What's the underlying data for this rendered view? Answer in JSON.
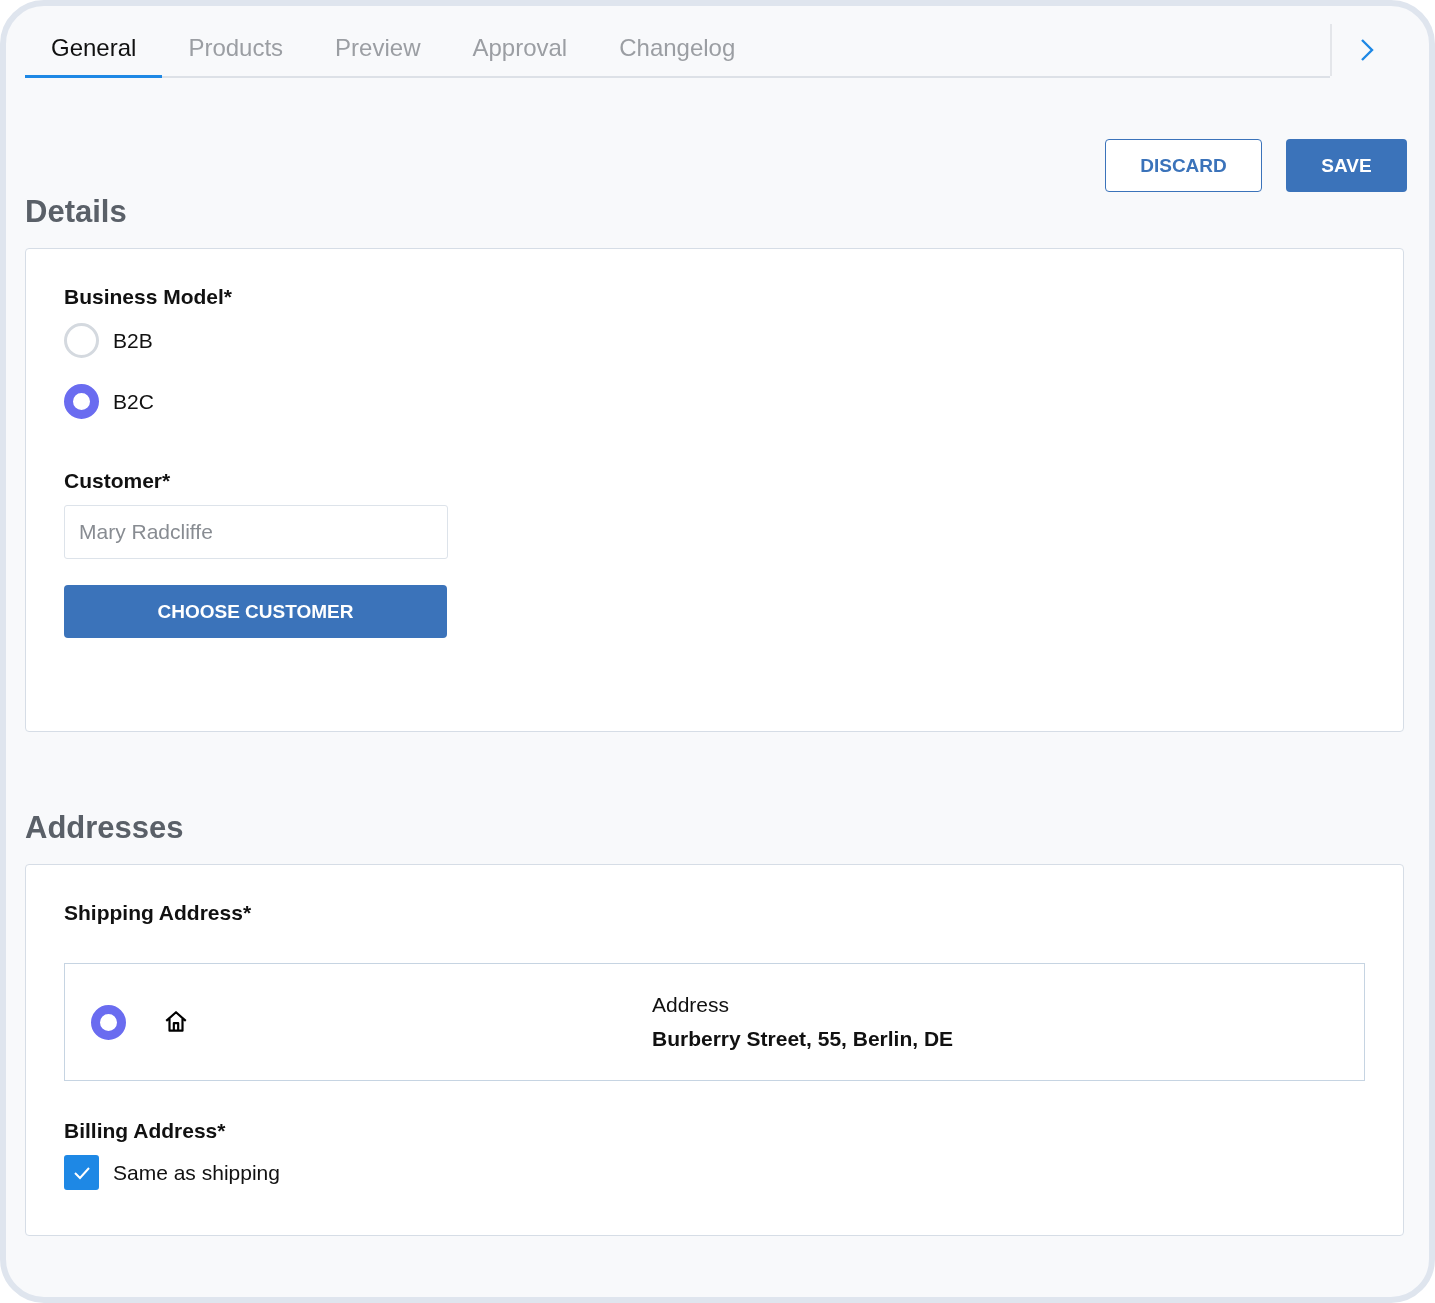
{
  "tabs": [
    {
      "label": "General",
      "selected": true
    },
    {
      "label": "Products",
      "selected": false
    },
    {
      "label": "Preview",
      "selected": false
    },
    {
      "label": "Approval",
      "selected": false
    },
    {
      "label": "Changelog",
      "selected": false
    }
  ],
  "actions": {
    "discard": "DISCARD",
    "save": "SAVE"
  },
  "details": {
    "title": "Details",
    "business_model": {
      "label": "Business Model*",
      "options": [
        {
          "label": "B2B",
          "selected": false
        },
        {
          "label": "B2C",
          "selected": true
        }
      ]
    },
    "customer": {
      "label": "Customer*",
      "value": "Mary Radcliffe",
      "button": "CHOOSE CUSTOMER"
    }
  },
  "addresses": {
    "title": "Addresses",
    "shipping": {
      "label": "Shipping Address*",
      "options": [
        {
          "selected": true,
          "heading": "Address",
          "address": "Burberry Street, 55, Berlin, DE"
        }
      ]
    },
    "billing": {
      "label": "Billing Address*",
      "same_as_shipping": {
        "label": "Same as shipping",
        "checked": true
      }
    }
  }
}
